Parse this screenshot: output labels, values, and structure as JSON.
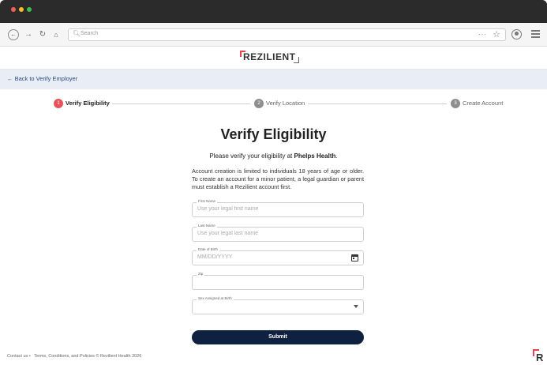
{
  "browser": {
    "url_placeholder": "Search",
    "more_label": "···",
    "star_label": "☆"
  },
  "site": {
    "logo_text": "REZILIENT",
    "back_link": "← Back to Verify Employer"
  },
  "stepper": {
    "steps": [
      {
        "number": "1",
        "label": "Verify Eligibility",
        "active": true
      },
      {
        "number": "2",
        "label": "Verify Location",
        "active": false
      },
      {
        "number": "3",
        "label": "Create Account",
        "active": false
      }
    ]
  },
  "form": {
    "heading": "Verify Eligibility",
    "sub_prefix": "Please verify your eligibility at ",
    "employer": "Phelps Health",
    "sub_suffix": ".",
    "notice": "Account creation is limited to individuals 18 years of age or older. To create an account for a minor patient, a legal guardian or parent must establish a Rezilient account first.",
    "fields": [
      {
        "label": "First Name",
        "placeholder": "Use your legal first name",
        "value": ""
      },
      {
        "label": "Last Name",
        "placeholder": "Use your legal last name",
        "value": ""
      },
      {
        "label": "Date of Birth",
        "placeholder": "MM/DD/YYYY",
        "value": ""
      },
      {
        "label": "Zip",
        "placeholder": "",
        "value": ""
      },
      {
        "label": "Sex Assigned at Birth",
        "placeholder": "",
        "value": ""
      }
    ],
    "submit_label": "Submit"
  },
  "footer": {
    "contact": "Contact us",
    "sep": "•",
    "terms": "Terms, Conditions, and Policies",
    "copyright": "© Rezilient Health 2026"
  },
  "colors": {
    "accent_red": "#e8525c",
    "button_navy": "#0f2140",
    "subbar_bg": "#e9eef6"
  }
}
